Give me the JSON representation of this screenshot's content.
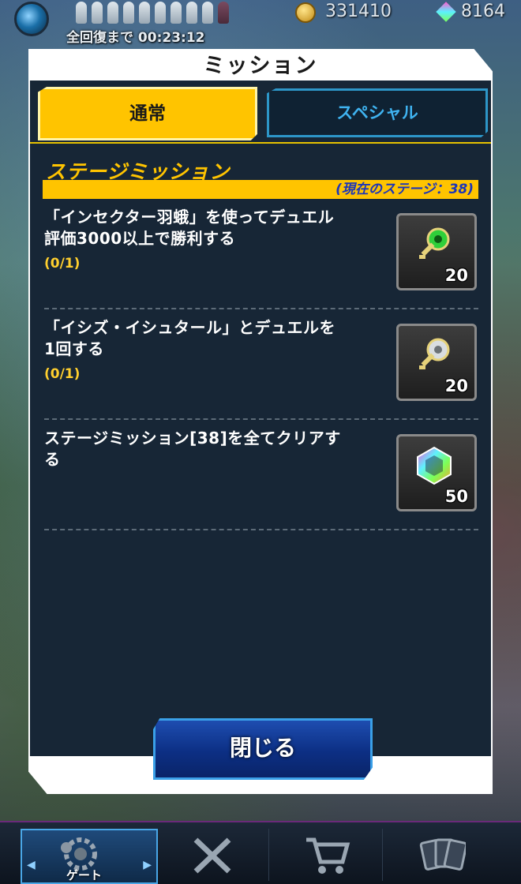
{
  "status_bar": {
    "recover_text": "全回復まで",
    "recover_time": "00:23:12",
    "coins": "331410",
    "gems": "8164"
  },
  "modal": {
    "title": "ミッション",
    "tabs": [
      {
        "label": "通常",
        "active": true
      },
      {
        "label": "スペシャル",
        "active": false
      }
    ],
    "section_title": "ステージミッション",
    "current_stage": "(現在のステージ：38)",
    "missions": [
      {
        "line1": "「インセクター羽蛾」を使ってデュエル",
        "line2": "評価3000以上で勝利する",
        "progress": "(0/1)",
        "reward_icon": "green-key-icon",
        "reward_count": "20"
      },
      {
        "line1": "「イシズ・イシュタール」とデュエルを",
        "line2": "1回する",
        "progress": "(0/1)",
        "reward_icon": "silver-key-icon",
        "reward_count": "20"
      },
      {
        "line1": "ステージミッション[38]を全てクリアす",
        "line2": "る",
        "progress": "",
        "reward_icon": "rainbow-gem-icon",
        "reward_count": "50"
      }
    ],
    "close_label": "閉じる"
  },
  "bottom_nav": {
    "gate_label": "ゲート"
  },
  "colors": {
    "accent_yellow": "#ffc400",
    "special_tab_text": "#3fb3f0",
    "stage_text": "#1c35b8",
    "panel_bg": "#172636"
  }
}
